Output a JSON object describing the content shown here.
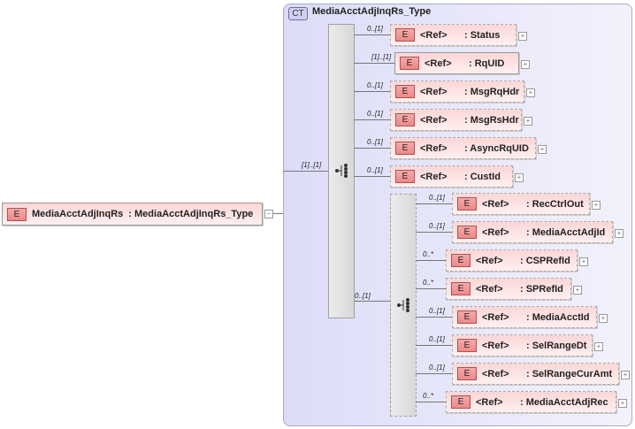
{
  "root": {
    "badge": "E",
    "name": "MediaAcctAdjInqRs",
    "type": ": MediaAcctAdjInqRs_Type",
    "toggle": "−"
  },
  "complex_type": {
    "badge": "CT",
    "name": "MediaAcctAdjInqRs_Type"
  },
  "sequence_occurrence": "[1]..[1]",
  "inner_sequence_occurrence": "0..[1]",
  "ref_label": "<Ref>",
  "element_badge": "E",
  "expand_symbol": "+",
  "sequence_children": [
    {
      "name": ": Status",
      "occurrence": "0..[1]",
      "optional": true
    },
    {
      "name": ": RqUID",
      "occurrence": "[1]..[1]",
      "optional": false
    },
    {
      "name": ": MsgRqHdr",
      "occurrence": "0..[1]",
      "optional": true
    },
    {
      "name": ": MsgRsHdr",
      "occurrence": "0..[1]",
      "optional": true
    },
    {
      "name": ": AsyncRqUID",
      "occurrence": "0..[1]",
      "optional": true
    },
    {
      "name": ": CustId",
      "occurrence": "0..[1]",
      "optional": true
    }
  ],
  "inner_sequence_children": [
    {
      "name": ": RecCtrlOut",
      "occurrence": "0..[1]",
      "optional": true
    },
    {
      "name": ": MediaAcctAdjId",
      "occurrence": "0..[1]",
      "optional": true
    },
    {
      "name": ": CSPRefId",
      "occurrence": "0..*",
      "optional": true
    },
    {
      "name": ": SPRefId",
      "occurrence": "0..*",
      "optional": true
    },
    {
      "name": ": MediaAcctId",
      "occurrence": "0..[1]",
      "optional": true
    },
    {
      "name": ": SelRangeDt",
      "occurrence": "0..[1]",
      "optional": true
    },
    {
      "name": ": SelRangeCurAmt",
      "occurrence": "0..[1]",
      "optional": true
    },
    {
      "name": ": MediaAcctAdjRec",
      "occurrence": "0..*",
      "optional": true
    }
  ]
}
